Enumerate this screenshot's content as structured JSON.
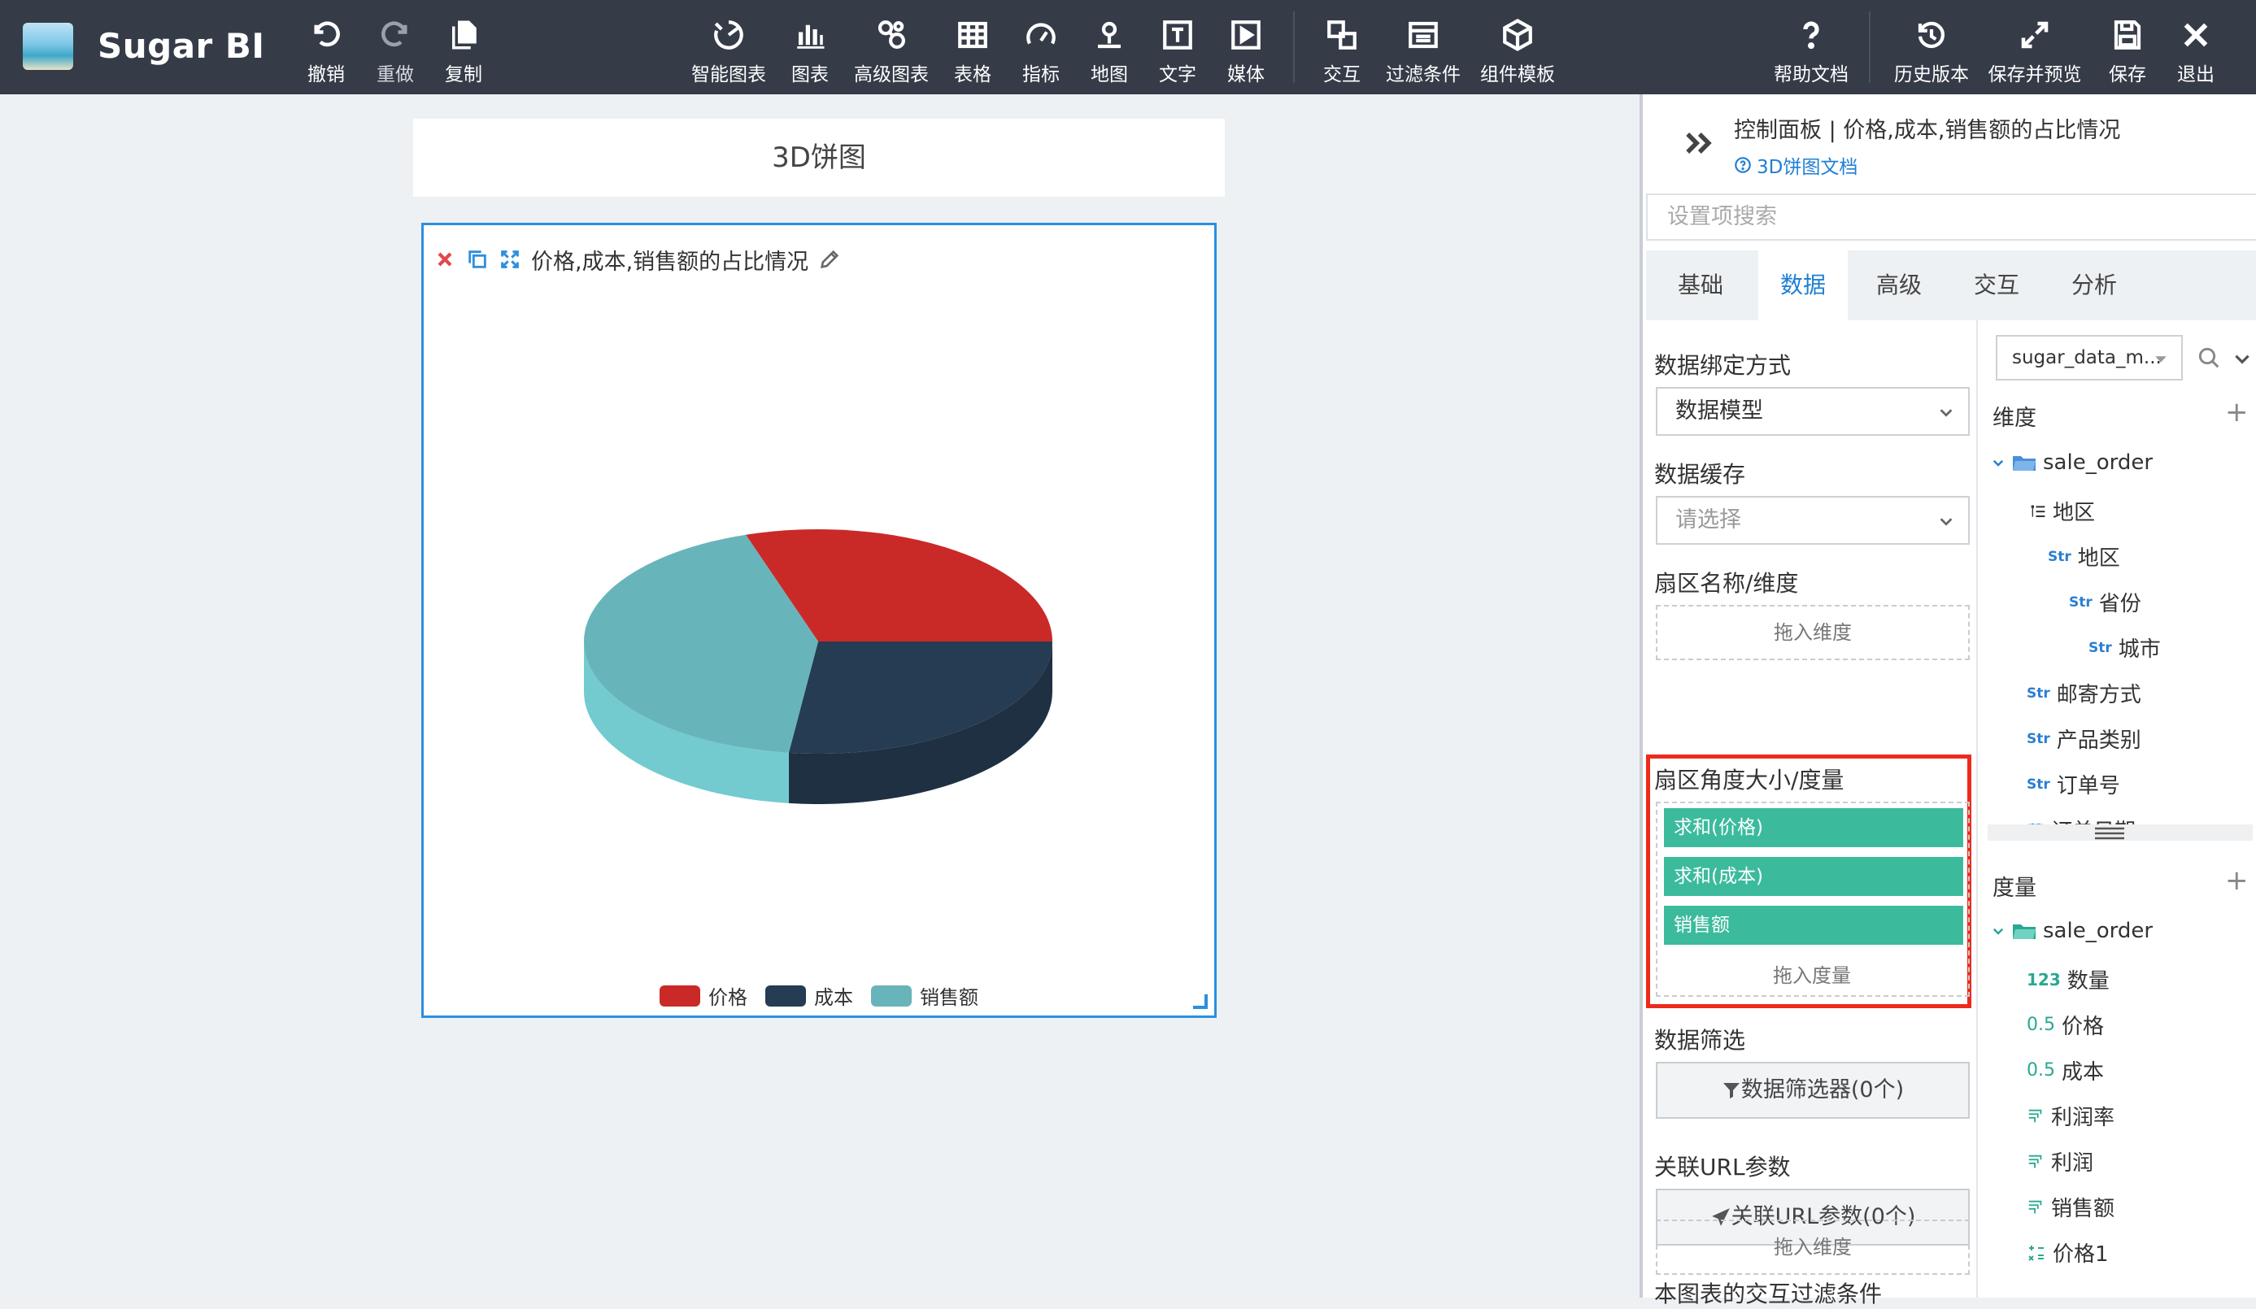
{
  "app": {
    "name": "Sugar BI"
  },
  "toolbar": {
    "left": [
      {
        "key": "undo",
        "label": "撤销"
      },
      {
        "key": "redo",
        "label": "重做"
      },
      {
        "key": "copy",
        "label": "复制"
      }
    ],
    "center": [
      {
        "key": "smart",
        "label": "智能图表"
      },
      {
        "key": "chart",
        "label": "图表"
      },
      {
        "key": "advanced",
        "label": "高级图表"
      },
      {
        "key": "table",
        "label": "表格"
      },
      {
        "key": "metric",
        "label": "指标"
      },
      {
        "key": "map",
        "label": "地图"
      },
      {
        "key": "text",
        "label": "文字"
      },
      {
        "key": "media",
        "label": "媒体"
      },
      {
        "key": "interact",
        "label": "交互"
      },
      {
        "key": "filter",
        "label": "过滤条件"
      },
      {
        "key": "template",
        "label": "组件模板"
      }
    ],
    "right": [
      {
        "key": "help",
        "label": "帮助文档"
      },
      {
        "key": "history",
        "label": "历史版本"
      },
      {
        "key": "save-preview",
        "label": "保存并预览"
      },
      {
        "key": "save",
        "label": "保存"
      },
      {
        "key": "exit",
        "label": "退出"
      }
    ]
  },
  "canvas": {
    "page_title": "3D饼图",
    "chart_title": "价格,成本,销售额的占比情况"
  },
  "chart_data": {
    "type": "pie",
    "categories": [
      "价格",
      "成本",
      "销售额"
    ],
    "values": [
      30,
      27,
      43
    ],
    "colors": [
      "#c92a28",
      "#253c52",
      "#67b5ba"
    ],
    "legend_position": "bottom"
  },
  "panel": {
    "breadcrumb": "控制面板 | 价格,成本,销售额的占比情况",
    "doc_link": "3D饼图文档",
    "search_placeholder": "设置项搜索",
    "tabs": [
      "基础",
      "数据",
      "高级",
      "交互",
      "分析"
    ],
    "active_tab": "数据",
    "binding_label": "数据绑定方式",
    "binding_value": "数据模型",
    "cache_label": "数据缓存",
    "cache_placeholder": "请选择",
    "sector_name_label": "扇区名称/维度",
    "drop_dimension": "拖入维度",
    "sector_angle_label": "扇区角度大小/度量",
    "measures": [
      "求和(价格)",
      "求和(成本)",
      "销售额"
    ],
    "drop_measure": "拖入度量",
    "filter_label": "数据筛选",
    "filter_button": "数据筛选器(0个)",
    "url_label": "关联URL参数",
    "url_button": "关联URL参数(0个)",
    "interact_label": "本图表的交互过滤条件",
    "drop_dimension2": "拖入维度",
    "source": "sugar_data_m...",
    "dimensions_header": "维度",
    "dimension_folder": "sale_order",
    "dimension_items": [
      {
        "type": "hier",
        "label": "地区"
      },
      {
        "type": "Str",
        "label": "地区"
      },
      {
        "type": "Str",
        "label": "省份"
      },
      {
        "type": "Str",
        "label": "城市"
      },
      {
        "type": "Str",
        "label": "邮寄方式"
      },
      {
        "type": "Str",
        "label": "产品类别"
      },
      {
        "type": "Str",
        "label": "订单号"
      },
      {
        "type": "date",
        "label": "订单日期"
      }
    ],
    "measures_header": "度量",
    "measure_folder": "sale_order",
    "measure_items": [
      {
        "type": "123",
        "label": "数量"
      },
      {
        "type": "0.5",
        "label": "价格"
      },
      {
        "type": "0.5",
        "label": "成本"
      },
      {
        "type": "calc",
        "label": "利润率"
      },
      {
        "type": "calc",
        "label": "利润"
      },
      {
        "type": "calc",
        "label": "销售额"
      },
      {
        "type": "formula",
        "label": "价格1"
      }
    ]
  }
}
